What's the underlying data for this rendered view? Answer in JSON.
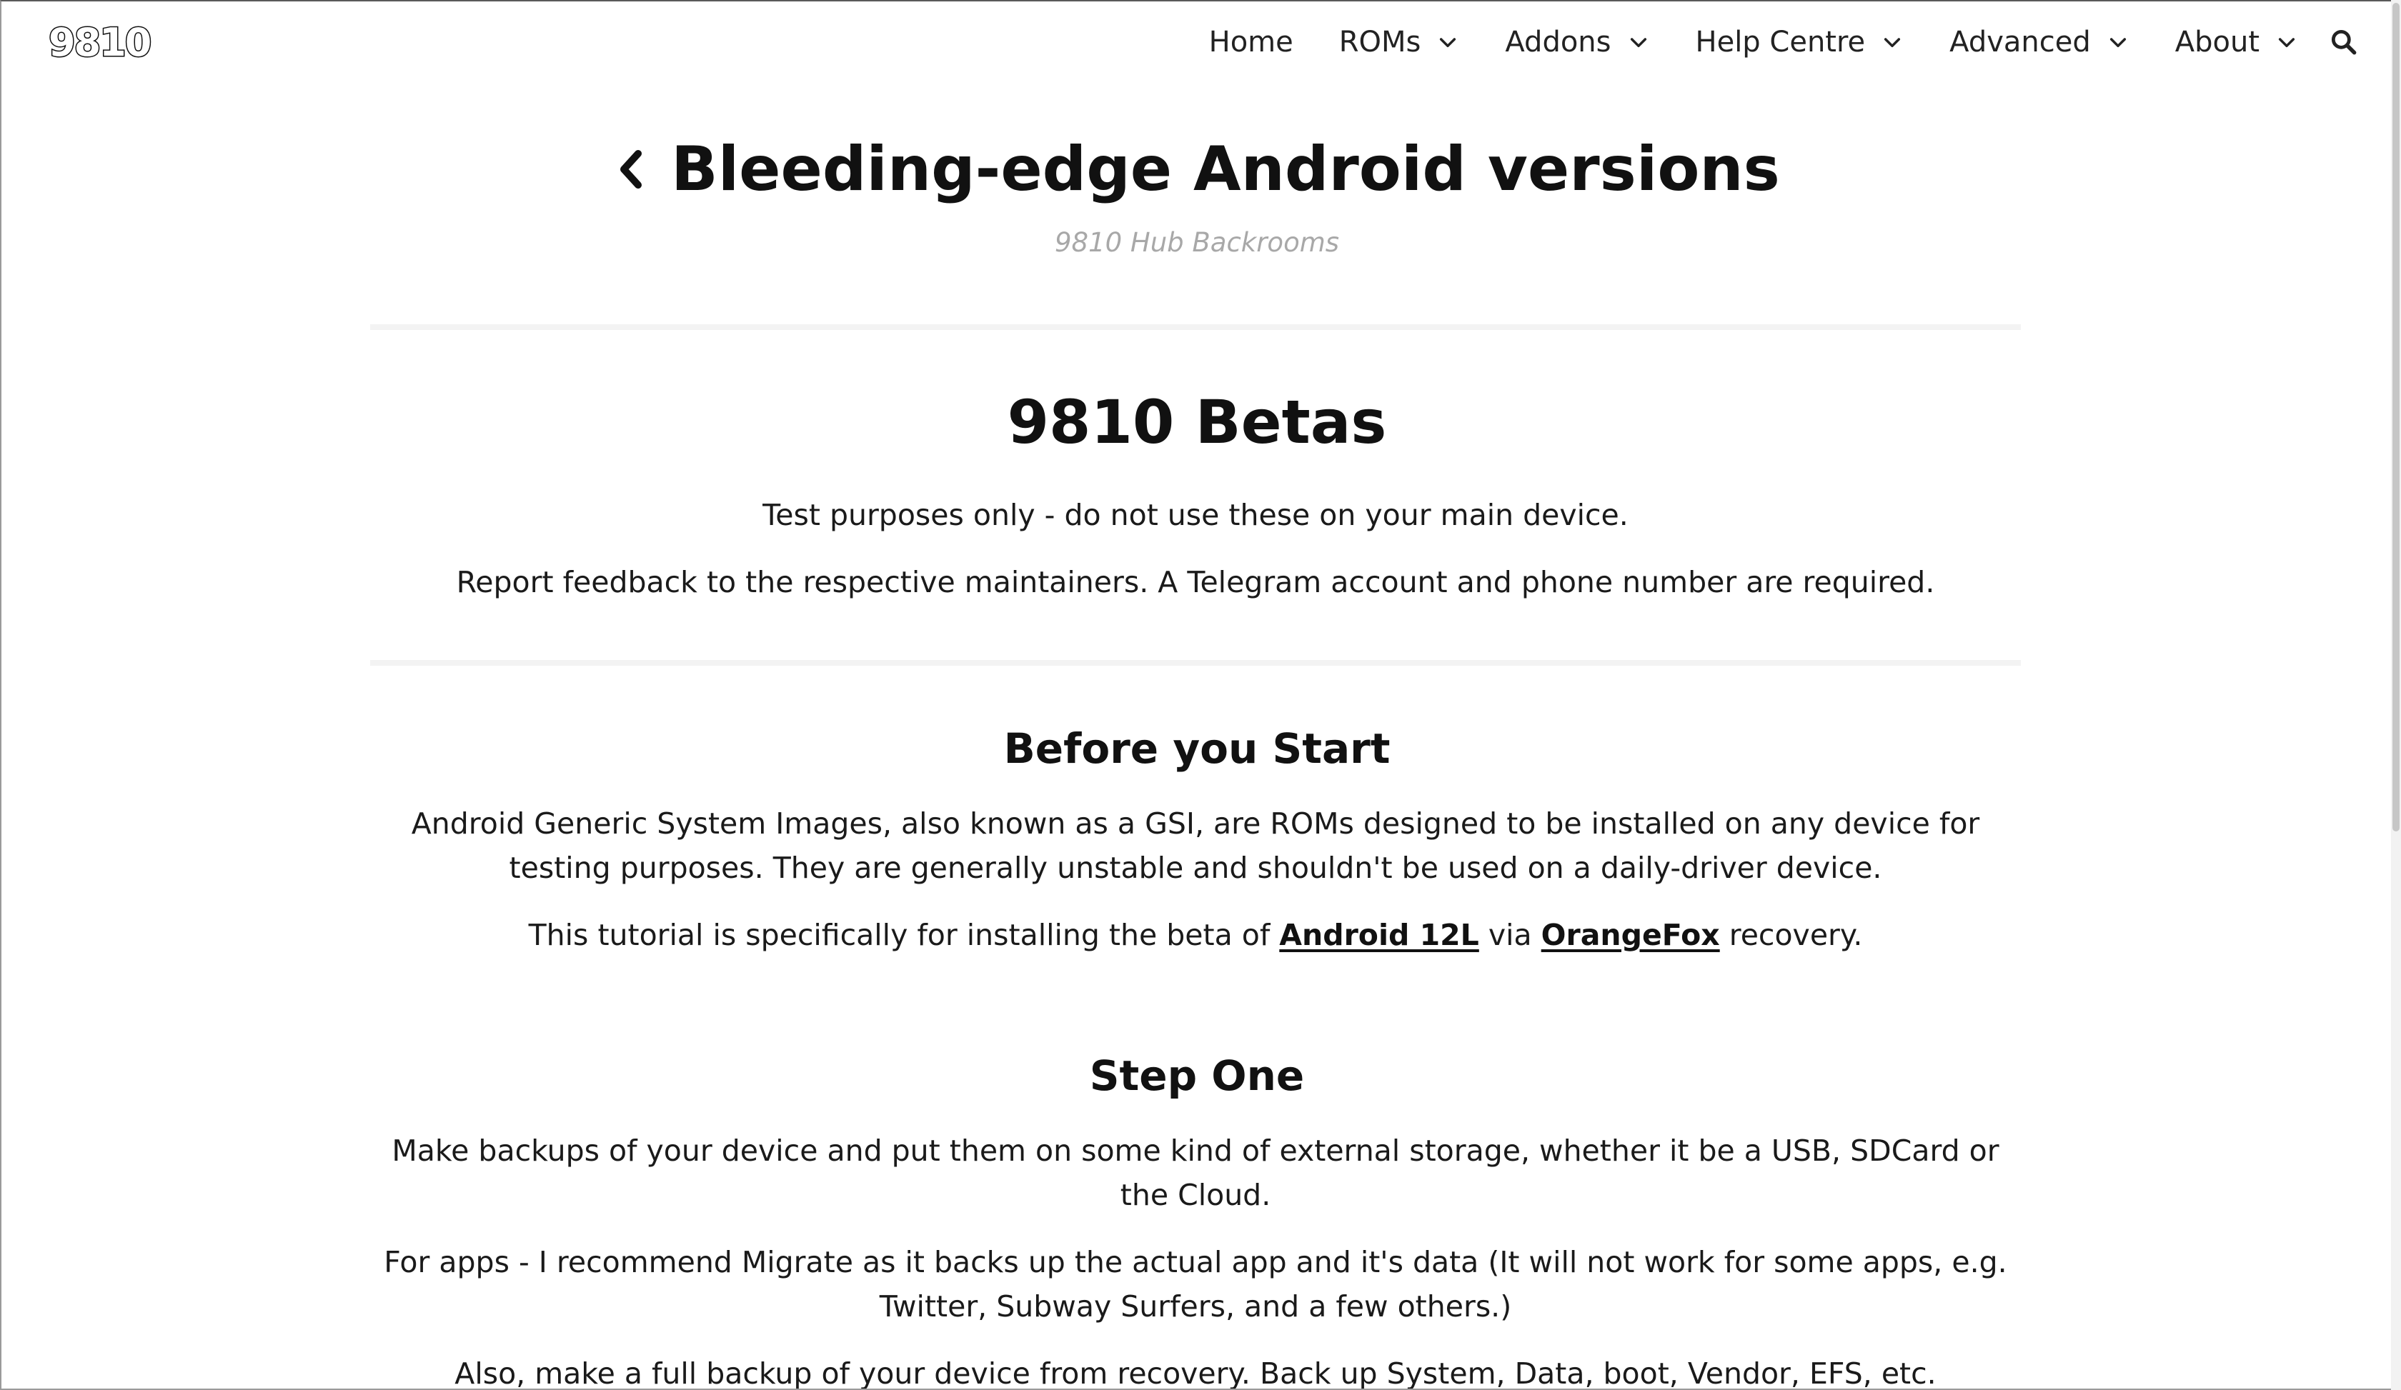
{
  "site": {
    "logo_text": "9810"
  },
  "nav": {
    "items": [
      {
        "label": "Home",
        "has_dropdown": false
      },
      {
        "label": "ROMs",
        "has_dropdown": true
      },
      {
        "label": "Addons",
        "has_dropdown": true
      },
      {
        "label": "Help Centre",
        "has_dropdown": true
      },
      {
        "label": "Advanced",
        "has_dropdown": true
      },
      {
        "label": "About",
        "has_dropdown": true
      }
    ],
    "search_icon": "search-icon"
  },
  "page": {
    "title": "Bleeding-edge Android versions",
    "subtitle": "9810 Hub Backrooms",
    "back_icon": "chevron-left-icon"
  },
  "sections": {
    "betas": {
      "heading": "9810 Betas",
      "p1": "Test purposes only - do not use these on your main device.",
      "p2": "Report feedback to the respective maintainers. A Telegram account and phone number are required."
    },
    "before": {
      "heading": "Before you Start",
      "p1": "Android Generic System Images, also known as a GSI, are ROMs designed to be installed on any device for testing purposes. They are generally unstable and shouldn't be used on a daily-driver device.",
      "p2_before": "This tutorial is specifically for installing the beta of ",
      "link_android": "Android 12L",
      "p2_mid": " via ",
      "link_orangefox": "OrangeFox",
      "p2_after": " recovery."
    },
    "step_one": {
      "heading": "Step One",
      "p1": "Make backups of your device and put them on some kind of external storage, whether it be a USB, SDCard or the Cloud.",
      "p2": "For apps - I recommend Migrate as it backs up the actual app and it's data (It will not work for some apps, e.g. Twitter, Subway Surfers, and a few others.)",
      "p3": "Also, make a full backup of your device from recovery. Back up System, Data, boot, Vendor, EFS, etc."
    }
  }
}
